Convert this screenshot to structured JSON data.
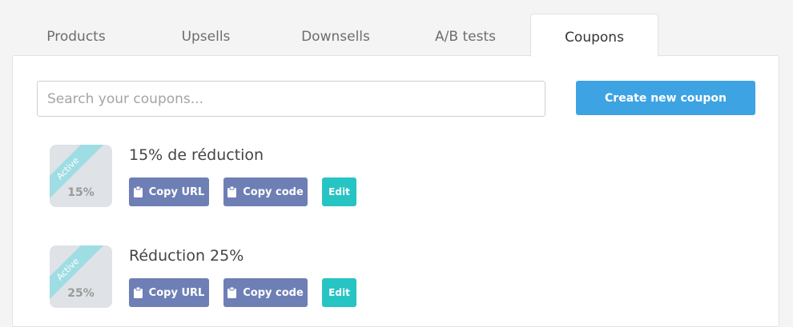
{
  "tabs": [
    {
      "label": "Products"
    },
    {
      "label": "Upsells"
    },
    {
      "label": "Downsells"
    },
    {
      "label": "A/B tests"
    },
    {
      "label": "Coupons"
    }
  ],
  "active_tab": "Coupons",
  "search": {
    "placeholder": "Search your coupons...",
    "value": ""
  },
  "create_button": {
    "label": "Create new coupon"
  },
  "coupons": [
    {
      "status": "Active",
      "discount": "15%",
      "name": "15% de réduction",
      "copy_url_label": "Copy URL",
      "copy_code_label": "Copy code",
      "edit_label": "Edit"
    },
    {
      "status": "Active",
      "discount": "25%",
      "name": "Réduction 25%",
      "copy_url_label": "Copy URL",
      "copy_code_label": "Copy code",
      "edit_label": "Edit"
    }
  ],
  "colors": {
    "primary": "#3da3e3",
    "copy_button": "#6e7fb5",
    "edit_button": "#27c4c4",
    "active_ribbon": "#9fdde4"
  },
  "icons": {
    "copy": "clipboard-icon"
  }
}
